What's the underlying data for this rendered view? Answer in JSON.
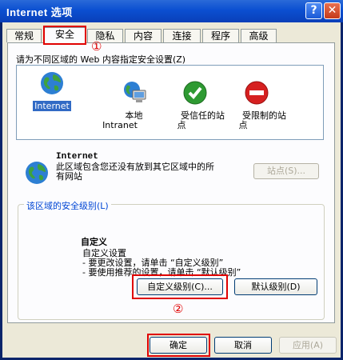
{
  "window": {
    "title": "Internet 选项",
    "help_glyph": "?",
    "close_glyph": "✕"
  },
  "tabs": [
    {
      "label": "常规"
    },
    {
      "label": "安全"
    },
    {
      "label": "隐私"
    },
    {
      "label": "内容"
    },
    {
      "label": "连接"
    },
    {
      "label": "程序"
    },
    {
      "label": "高级"
    }
  ],
  "security": {
    "instruction": "请为不同区域的 Web 内容指定安全设置(Z)",
    "zones": [
      {
        "label": "Internet",
        "icon": "globe-icon",
        "selected": true
      },
      {
        "label": "本地\nIntranet",
        "icon": "local-intranet-icon"
      },
      {
        "label": "受信任的站\n点",
        "icon": "trusted-sites-icon"
      },
      {
        "label": "受限制的站\n点",
        "icon": "restricted-sites-icon"
      }
    ],
    "zone_info": {
      "title": "Internet",
      "description": "此区域包含您还没有放到其它区域中的所有网站"
    },
    "sites_button": "站点(S)...",
    "level_group": {
      "legend": "该区域的安全级别(L)",
      "level_name": "自定义",
      "level_desc": "自定义设置\n- 要更改设置，请单击 “自定义级别”\n- 要使用推荐的设置，请单击 “默认级别”"
    },
    "custom_level_button": "自定义级别(C)...",
    "default_level_button": "默认级别(D)"
  },
  "annotations": {
    "marker1": "①",
    "marker2": "②"
  },
  "dialog_buttons": {
    "ok": "确定",
    "cancel": "取消",
    "apply": "应用(A)"
  },
  "colors": {
    "title_bar": "#0b4fd1",
    "annotation_red": "#e00000",
    "selection": "#316ac5"
  }
}
